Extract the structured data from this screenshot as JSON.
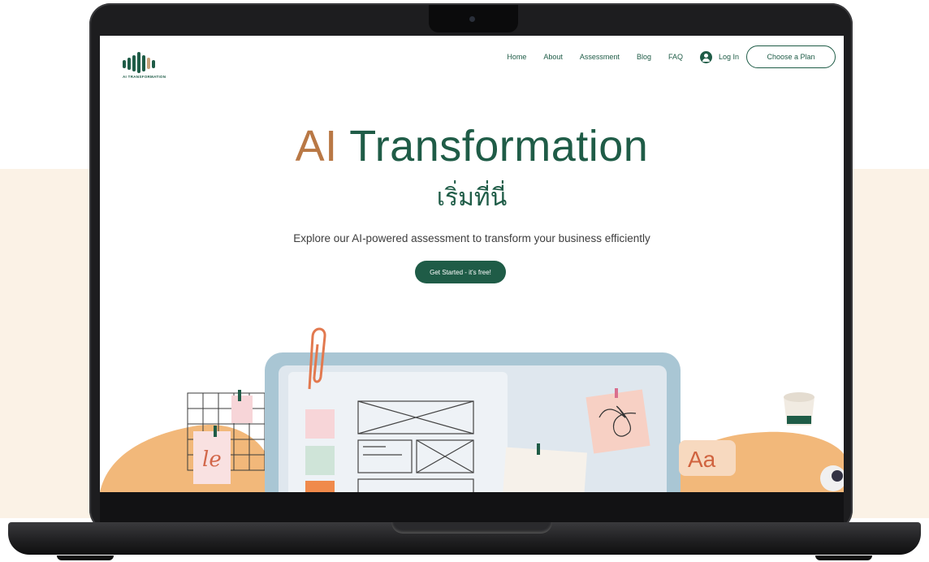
{
  "site": {
    "logo_text": "AI TRANSFORMATION",
    "nav": [
      "Home",
      "About",
      "Assessment",
      "Blog",
      "FAQ"
    ],
    "login_label": "Log In",
    "plan_button": "Choose a Plan"
  },
  "hero": {
    "title_accent": "AI",
    "title_rest": "Transformation",
    "subtitle": "เริ่มที่นี่",
    "description": "Explore our AI-powered assessment to transform your business efficiently",
    "cta_label": "Get Started - it's free!"
  },
  "illustration": {
    "sticker_text": "Aa",
    "note_text": "le"
  },
  "colors": {
    "brand_green": "#1f5c47",
    "accent_orange": "#b97845",
    "backdrop_cream": "#fbf2e6"
  },
  "icons": [
    "user-circle-icon",
    "paperclip-icon",
    "pushpin-icon"
  ]
}
